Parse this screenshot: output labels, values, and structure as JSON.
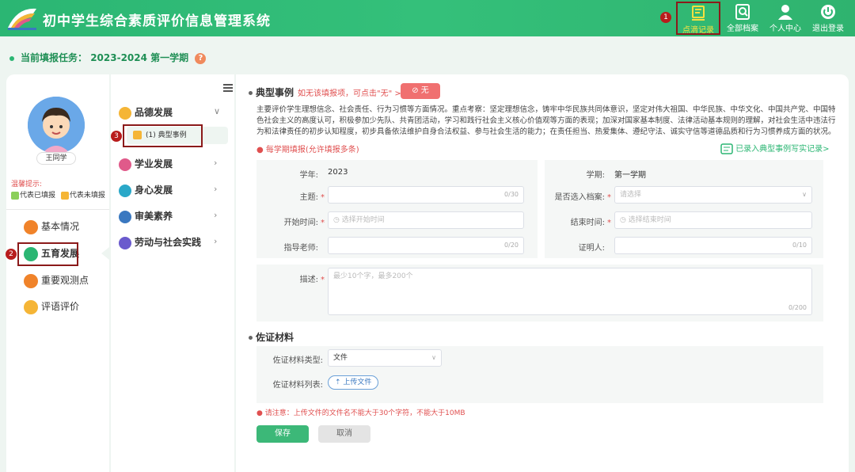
{
  "header": {
    "app_title": "初中学生综合素质评价信息管理系统",
    "nav": [
      {
        "label": "点滴记录",
        "icon": "record-icon"
      },
      {
        "label": "全部档案",
        "icon": "archive-icon"
      },
      {
        "label": "个人中心",
        "icon": "user-icon"
      },
      {
        "label": "退出登录",
        "icon": "power-icon"
      }
    ],
    "step1": "1"
  },
  "task": {
    "label": "当前填报任务：",
    "value": "2023-2024 第一学期",
    "help": "?"
  },
  "student": {
    "name": "王同学",
    "legend_title": "温馨提示:",
    "legend_filled": "代表已填报",
    "legend_unfilled": "代表未填报"
  },
  "left_menu": [
    {
      "label": "基本情况",
      "color": "#f0832a"
    },
    {
      "label": "五育发展",
      "color": "#2bb673"
    },
    {
      "label": "重要观测点",
      "color": "#f0832a"
    },
    {
      "label": "评语评价",
      "color": "#f5b536"
    }
  ],
  "step2": "2",
  "categories": [
    {
      "label": "品德发展",
      "color": "#f5b536",
      "chev": "∨"
    },
    {
      "label": "学业发展",
      "color": "#e05a8a",
      "chev": "›"
    },
    {
      "label": "身心发展",
      "color": "#2aa8c8",
      "chev": "›"
    },
    {
      "label": "审美素养",
      "color": "#3a78c0",
      "chev": "›"
    },
    {
      "label": "劳动与社会实践",
      "color": "#6a5acd",
      "chev": "›"
    }
  ],
  "sub_item": "(1) 典型事例",
  "step3": "3",
  "main": {
    "section_title": "典型事例",
    "hint": "如无该填报项，可点击\"无\" >",
    "none_button": "无",
    "description": "主要评价学生理想信念、社会责任、行为习惯等方面情况。重点考察：坚定理想信念，铸牢中华民族共同体意识，坚定对伟大祖国、中华民族、中华文化、中国共产党、中国特色社会主义的高度认可，积极参加少先队、共青团活动，学习和践行社会主义核心价值观等方面的表现；加深对国家基本制度、法律活动基本规则的理解，对社会生活中违法行为和法律责任的初步认知程度，初步具备依法维护自身合法权益、参与社会生活的能力；在责任担当、热爱集体、遵纪守法、诚实守信等道德品质和行为习惯养成方面的状况。",
    "each_term": "每学期填报(允许填报多条)",
    "record_link": "已录入典型事例写实记录>",
    "form": {
      "year_label": "学年:",
      "year_value": "2023",
      "term_label": "学期:",
      "term_value": "第一学期",
      "topic_label": "主题:",
      "topic_count": "0/30",
      "archive_label": "是否选入档案:",
      "archive_placeholder": "请选择",
      "start_label": "开始时间:",
      "start_placeholder": "选择开始时间",
      "end_label": "结束时间:",
      "end_placeholder": "选择结束时间",
      "teacher_label": "指导老师:",
      "teacher_count": "0/20",
      "witness_label": "证明人:",
      "witness_count": "0/10",
      "desc_label": "描述:",
      "desc_placeholder": "最少10个字，最多200个",
      "desc_count": "0/200"
    },
    "evidence_title": "佐证材料",
    "evidence_type_label": "佐证材料类型:",
    "evidence_type_value": "文件",
    "evidence_list_label": "佐证材料列表:",
    "upload_button": "上传文件",
    "warning": "请注意：上传文件的文件名不能大于30个字符，不能大于10MB",
    "save_button": "保存",
    "cancel_button": "取消"
  },
  "colors": {
    "brand": "#2bb673",
    "danger": "#e05050",
    "annotation": "#8b1a1a"
  }
}
